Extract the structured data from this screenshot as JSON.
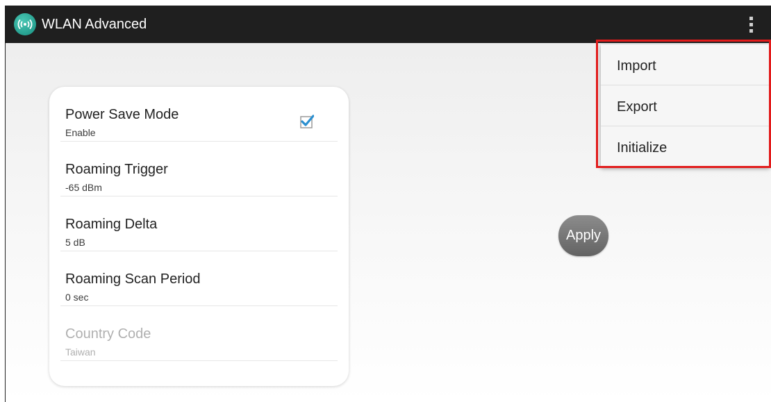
{
  "app": {
    "title": "WLAN Advanced",
    "icon": "wifi-signal-icon",
    "accent_color": "#1fa391"
  },
  "toolbar": {
    "overflow_icon": "more-vert-icon"
  },
  "preferences": [
    {
      "title": "Power Save Mode",
      "summary": "Enable",
      "checked": true,
      "enabled": true
    },
    {
      "title": "Roaming Trigger",
      "summary": "-65 dBm",
      "enabled": true
    },
    {
      "title": "Roaming Delta",
      "summary": "5 dB",
      "enabled": true
    },
    {
      "title": "Roaming Scan Period",
      "summary": "0 sec",
      "enabled": true
    },
    {
      "title": "Country Code",
      "summary": "Taiwan",
      "enabled": false
    }
  ],
  "apply_button": {
    "label": "Apply"
  },
  "menu": {
    "items": [
      {
        "label": "Import"
      },
      {
        "label": "Export"
      },
      {
        "label": "Initialize"
      }
    ],
    "highlight_color": "#e21b1b"
  }
}
